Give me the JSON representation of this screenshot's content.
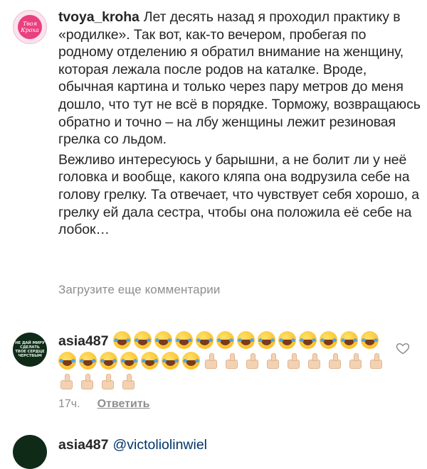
{
  "comment": {
    "username": "tvoya_kroha",
    "avatar_text": "Твоя Кроха",
    "paragraph1": "Лет десять назад я проходил практику в «родилке». Так вот, как-то вечером, пробегая по родному отделению я обратил внимание на женщину, которая лежала после родов на каталке. Вроде, обычная картина и только через пару метров до меня дошло, что тут не всё в порядке. Торможу, возвращаюсь обратно и точно – на лбу женщины лежит резиновая грелка со льдом.",
    "paragraph2": "Вежливо интересуюсь у барышни, а не болит ли у неё головка и вообще, какого кляпа она водрузила себе на голову грелку. Та отвечает, что чувствует себя хорошо, а грелку ей дала сестра, чтобы она положила её себе на лобок…"
  },
  "load_more": "Загрузите еще комментарии",
  "reply": {
    "username": "asia487",
    "avatar_text": "НЕ ДАЙ МИРУ СДЕЛАТЬ ТВОЕ СЕРДЦЕ ЧЕРСТВЫМ",
    "emoji": [
      "😂 x20",
      "👍🏻 x13"
    ],
    "laugh_count": 20,
    "thumbs_count": 13,
    "time": "17ч.",
    "reply_label": "Ответить",
    "like_icon": "heart-outline-icon"
  },
  "next_comment": {
    "username": "asia487",
    "mention": "@victoliolinwiel"
  },
  "colors": {
    "text": "#262626",
    "muted": "#8e8e8e",
    "mention": "#003569"
  }
}
